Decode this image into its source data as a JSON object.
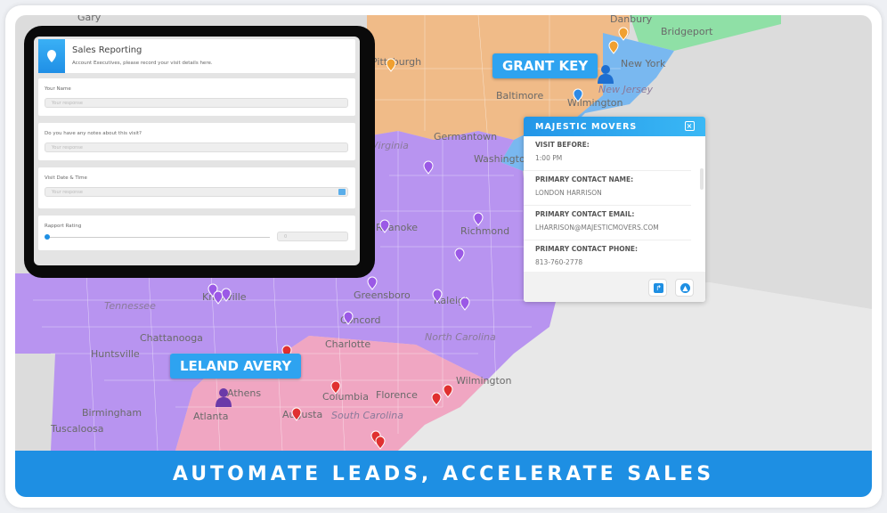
{
  "banner": {
    "text": "AUTOMATE LEADS, ACCELERATE SALES"
  },
  "form": {
    "title": "Sales Reporting",
    "subtitle": "Account Executives, please record your visit details here.",
    "fields": [
      {
        "label": "Your Name",
        "placeholder": "Your response"
      },
      {
        "label": "Do you have any notes about this visit?",
        "placeholder": "Your response"
      },
      {
        "label": "Visit Date & Time",
        "placeholder": "Your response"
      }
    ],
    "rating": {
      "label": "Rapport Rating",
      "value": "0",
      "level": 0
    }
  },
  "popup": {
    "title": "MAJESTIC MOVERS",
    "fields": [
      {
        "key": "VISIT BEFORE:",
        "value": "1:00 PM"
      },
      {
        "key": "PRIMARY CONTACT NAME:",
        "value": "LONDON HARRISON"
      },
      {
        "key": "PRIMARY CONTACT EMAIL:",
        "value": "LHARRISON@MAJESTICMOVERS.COM"
      },
      {
        "key": "PRIMARY CONTACT PHONE:",
        "value": "813-760-2778"
      }
    ]
  },
  "reps": [
    {
      "name": "GRANT KEY"
    },
    {
      "name": "LELAND AVERY"
    }
  ],
  "map": {
    "labels": [
      "Gary",
      "Pittsburgh",
      "Danbury",
      "Bridgeport",
      "New York",
      "New Jersey",
      "Wilmington",
      "Baltimore",
      "Germantown",
      "Washington D.C.",
      "Virginia",
      "Roanoke",
      "Richmond",
      "Knoxville",
      "Tennessee",
      "Greensboro",
      "Raleigh",
      "Concord",
      "Charlotte",
      "North Carolina",
      "Chattanooga",
      "Huntsville",
      "Birmingham",
      "Tuscaloosa",
      "Athens",
      "Atlanta",
      "Augusta",
      "Columbia",
      "South Carolina",
      "Florence",
      "Wilmington"
    ],
    "colors": {
      "orange": "#f2b77e",
      "green": "#8fe0a6",
      "blue": "#79b8f0",
      "purple": "#b48cf2",
      "pink": "#f2a0bf",
      "base": "#dcdcdc"
    }
  }
}
